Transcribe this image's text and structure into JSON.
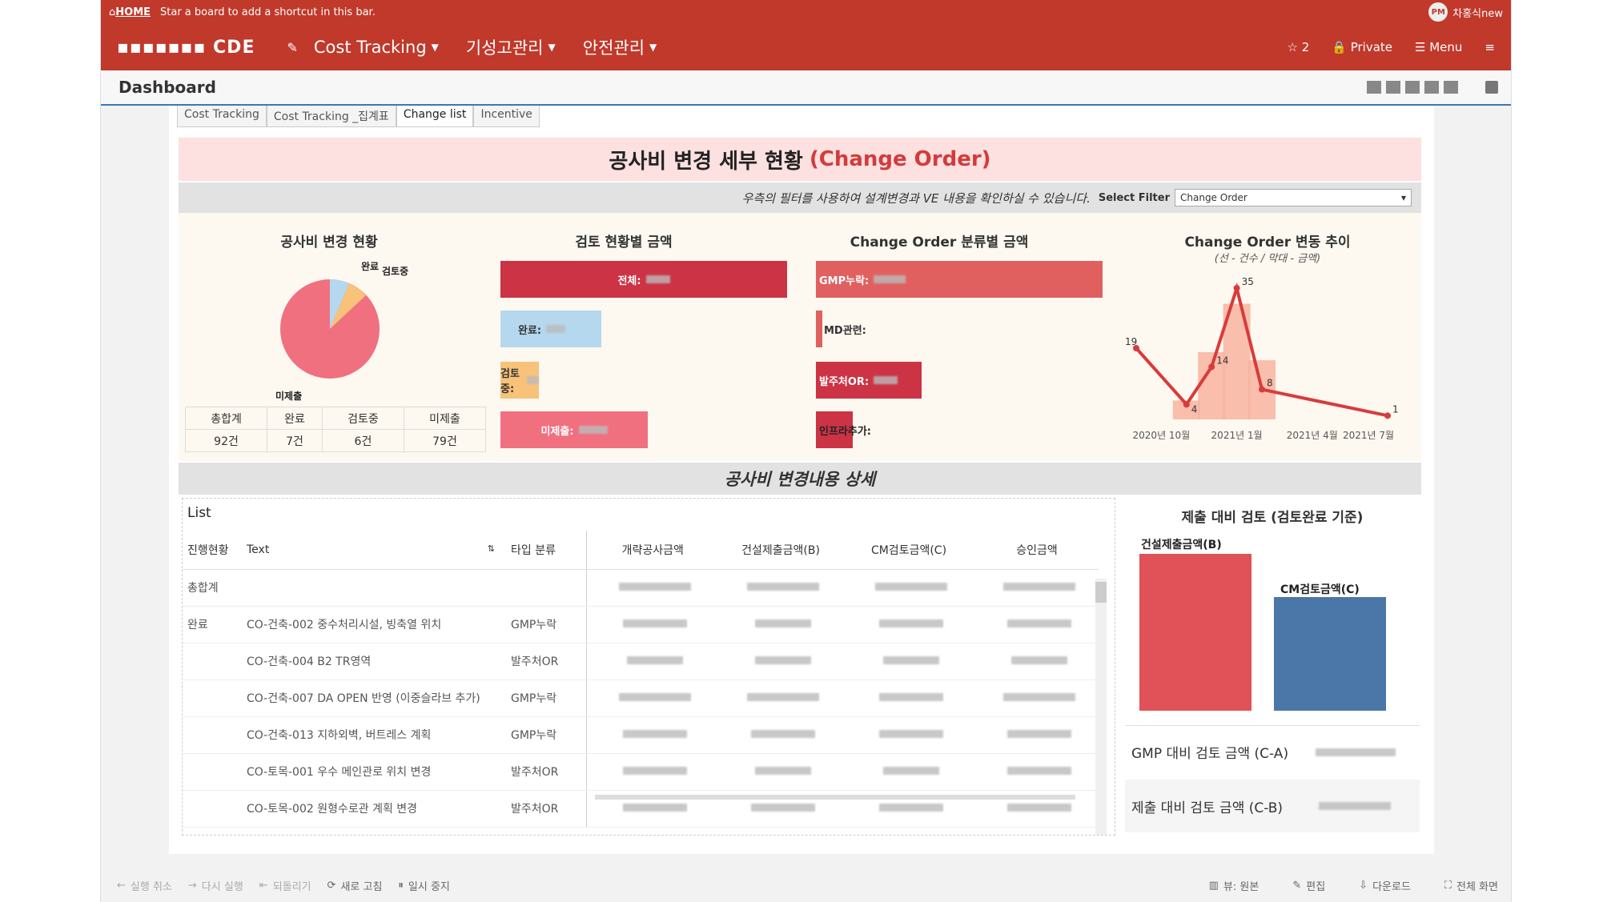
{
  "topbar": {
    "home": "HOME",
    "hint": "Star a board to add a shortcut in this bar.",
    "avatar": "PM",
    "username": "차홍식new"
  },
  "navbar": {
    "logo": "▪▪▪▪▪▪▪ CDE",
    "items": [
      {
        "label": "Cost Tracking"
      },
      {
        "label": "기성고관리"
      },
      {
        "label": "안전관리"
      }
    ],
    "star_count": "2",
    "private": "Private",
    "menu": "Menu"
  },
  "dashboard": {
    "title": "Dashboard"
  },
  "tabs": [
    {
      "label": "Cost Tracking"
    },
    {
      "label": "Cost Tracking _집계표"
    },
    {
      "label": "Change list"
    },
    {
      "label": "Incentive"
    }
  ],
  "banner": {
    "title": "공사비 변경 세부 현황",
    "highlight": "(Change Order)"
  },
  "filter": {
    "hint": "우측의 필터를 사용하여 설계변경과 VE 내용을 확인하실 수 있습니다.",
    "label": "Select Filter",
    "value": "Change Order"
  },
  "pie": {
    "title": "공사비 변경 현황",
    "labels": [
      "완료",
      "검토중",
      "미제출"
    ]
  },
  "summary": {
    "headers": [
      "총합계",
      "완료",
      "검토중",
      "미제출"
    ],
    "values": [
      "92건",
      "7건",
      "6건",
      "79건"
    ]
  },
  "review_chart": {
    "title": "검토 현황별 금액",
    "bars": [
      {
        "label": "전체:"
      },
      {
        "label": "완료:"
      },
      {
        "label": "검토중:"
      },
      {
        "label": "미제출:"
      }
    ]
  },
  "category_chart": {
    "title": "Change Order 분류별 금액",
    "bars": [
      {
        "label": "GMP누락:"
      },
      {
        "label": "MD관련:"
      },
      {
        "label": "발주처OR:"
      },
      {
        "label": "인프라추가:"
      }
    ]
  },
  "trend_chart": {
    "title": "Change Order 변동 추이",
    "subtitle": "(선 - 건수 / 막대 - 금액)",
    "x_ticks": [
      "2020년 10월",
      "2021년 1월",
      "2021년 4월",
      "2021년 7월"
    ]
  },
  "chart_data": {
    "type": "line",
    "title": "Change Order 변동 추이",
    "subtitle": "(선 - 건수 / 막대 - 금액)",
    "series": [
      {
        "name": "건수",
        "points": [
          {
            "x": "2020-09",
            "y": 19
          },
          {
            "x": "2020-11",
            "y": 4
          },
          {
            "x": "2020-12",
            "y": 14
          },
          {
            "x": "2021-01",
            "y": 35
          },
          {
            "x": "2021-02",
            "y": 8
          },
          {
            "x": "2021-07",
            "y": 1
          }
        ]
      }
    ],
    "bar_amount_relative": [
      {
        "x": "2020-11",
        "v": 0.14
      },
      {
        "x": "2020-12",
        "v": 0.5
      },
      {
        "x": "2021-01",
        "v": 0.86
      },
      {
        "x": "2021-02",
        "v": 0.44
      }
    ],
    "x_ticks": [
      "2020년 10월",
      "2021년 1월",
      "2021년 4월",
      "2021년 7월"
    ]
  },
  "section": {
    "title": "공사비 변경내용 상세"
  },
  "list": {
    "title": "List",
    "headers": [
      "진행현황",
      "Text",
      "타입 분류",
      "개략공사금액",
      "건설제출금액(B)",
      "CM검토금액(C)",
      "승인금액"
    ],
    "total_label": "총합계",
    "rows": [
      {
        "status": "완료",
        "text": "CO-건축-002 중수처리시설, 빙축열 위치",
        "type": "GMP누락"
      },
      {
        "status": "",
        "text": "CO-건축-004 B2 TR영역",
        "type": "발주처OR"
      },
      {
        "status": "",
        "text": "CO-건축-007 DA OPEN 반영 (이중슬라브 추가)",
        "type": "GMP누락"
      },
      {
        "status": "",
        "text": "CO-건축-013 지하외벽, 버트레스 계획",
        "type": "GMP누락"
      },
      {
        "status": "",
        "text": "CO-토목-001 우수 메인관로 위치 변경",
        "type": "발주처OR"
      },
      {
        "status": "",
        "text": "CO-토목-002 원형수로관 계획 변경",
        "type": "발주처OR"
      }
    ]
  },
  "compare": {
    "title": "제출 대비 검토 (검토완료 기준)",
    "bar_b": "건설제출금액(B)",
    "bar_c": "CM검토금액(C)",
    "values_relative": {
      "b": 1.0,
      "c": 0.72
    },
    "metric1": "GMP 대비 검토 금액 (C-A)",
    "metric2": "제출 대비 검토 금액 (C-B)"
  },
  "bottom": {
    "undo": "실행 취소",
    "redo": "다시 실행",
    "revert": "되돌리기",
    "refresh": "새로 고침",
    "pause": "일시 중지",
    "view": "뷰: 원본",
    "edit": "편집",
    "download": "다운로드",
    "fullscreen": "전체 화면"
  },
  "colors": {
    "red_bar": "#cc3344",
    "light_red": "#e06060",
    "blue": "#4a76a8",
    "pink": "#f07080",
    "light_blue": "#b5d8ee",
    "orange": "#f8c27a",
    "pink_band": "#fde0e0"
  }
}
